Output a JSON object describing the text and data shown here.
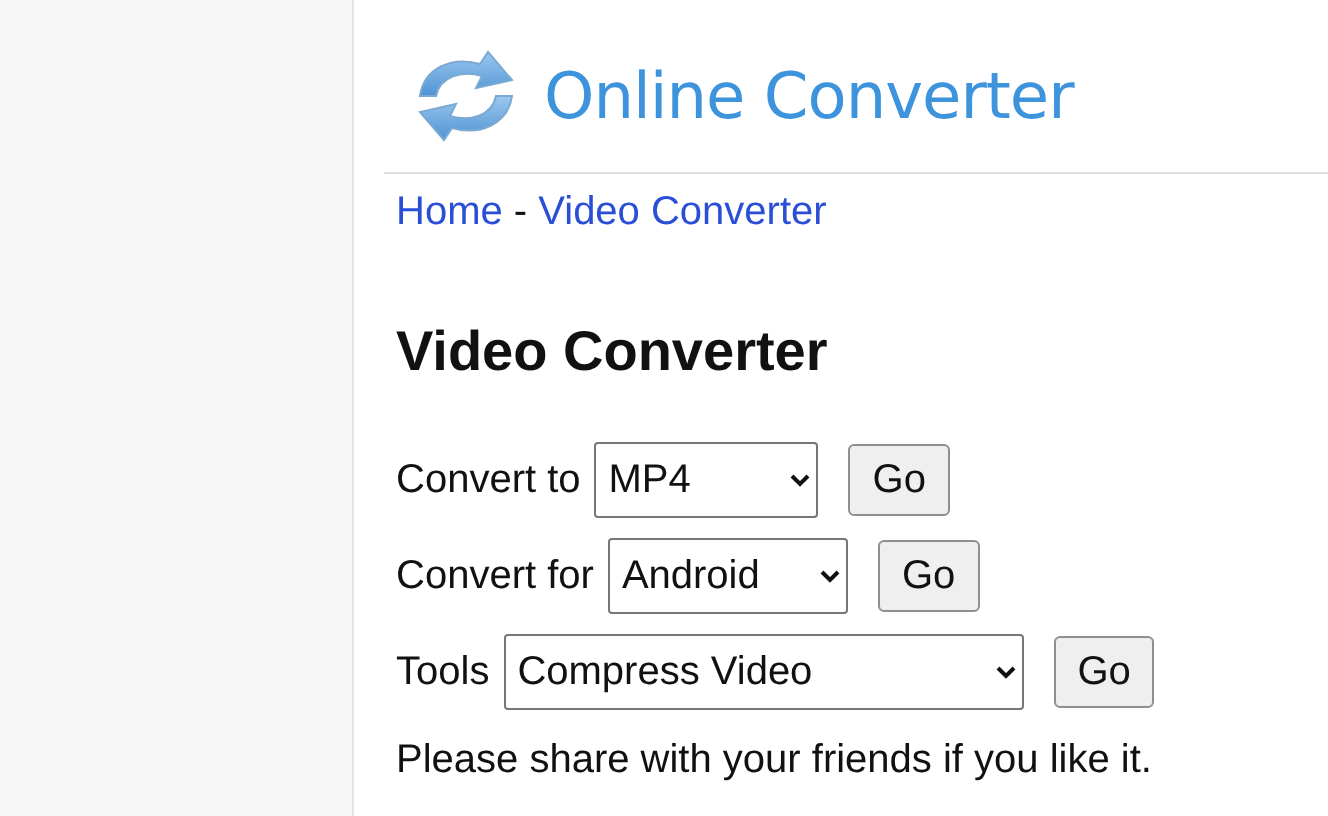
{
  "logo": {
    "title": "Online Converter"
  },
  "breadcrumb": {
    "items": [
      {
        "label": "Home"
      },
      {
        "label": "Video Converter"
      }
    ],
    "separator": "-"
  },
  "heading": "Video Converter",
  "rows": [
    {
      "label": "Convert to",
      "value": "MP4",
      "button": "Go"
    },
    {
      "label": "Convert for",
      "value": "Android",
      "button": "Go"
    },
    {
      "label": "Tools",
      "value": "Compress Video",
      "button": "Go"
    }
  ],
  "note": "Please share with your friends if you like it."
}
